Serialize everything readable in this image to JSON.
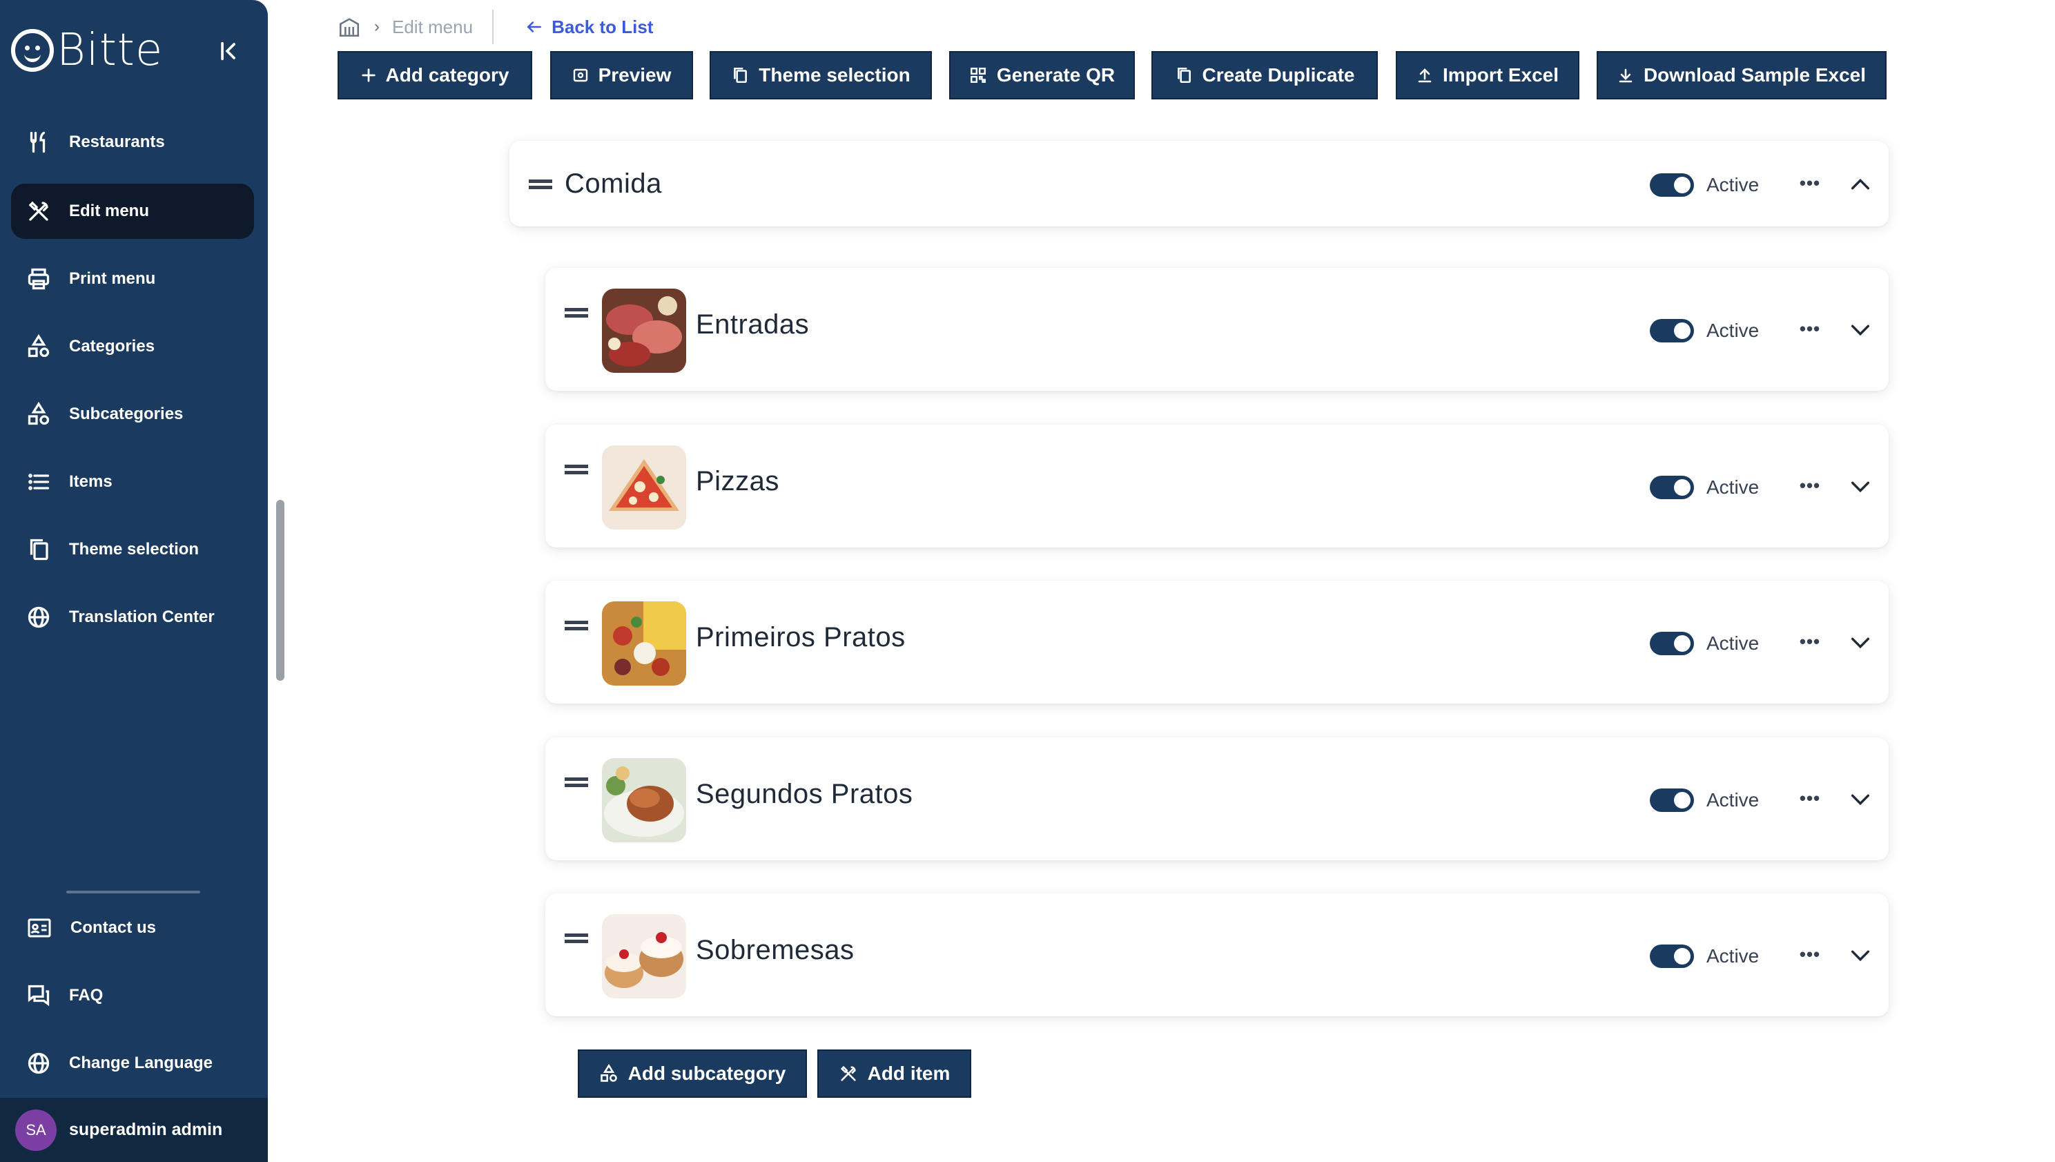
{
  "app": {
    "logo_text": "Bitte"
  },
  "sidebar": {
    "items": [
      {
        "label": "Restaurants",
        "icon": "fork-knife-icon"
      },
      {
        "label": "Edit menu",
        "icon": "crossed-utensils-icon"
      },
      {
        "label": "Print menu",
        "icon": "printer-icon"
      },
      {
        "label": "Categories",
        "icon": "shapes-icon"
      },
      {
        "label": "Subcategories",
        "icon": "shapes-icon"
      },
      {
        "label": "Items",
        "icon": "list-icon"
      },
      {
        "label": "Theme selection",
        "icon": "copy-document-icon"
      },
      {
        "label": "Translation Center",
        "icon": "globe-icon"
      }
    ],
    "bottom_items": [
      {
        "label": "Contact us",
        "icon": "contact-card-icon"
      },
      {
        "label": "FAQ",
        "icon": "chat-bubbles-icon"
      },
      {
        "label": "Change Language",
        "icon": "globe-icon"
      }
    ],
    "user": {
      "initials": "SA",
      "name": "superadmin admin"
    }
  },
  "header": {
    "breadcrumb_current": "Edit menu",
    "back_label": "Back to List"
  },
  "toolbar": {
    "add_category": "Add category",
    "preview": "Preview",
    "theme_selection": "Theme selection",
    "generate_qr": "Generate QR",
    "create_duplicate": "Create Duplicate",
    "import_excel": "Import Excel",
    "download_sample": "Download Sample Excel"
  },
  "category": {
    "name": "Comida",
    "status": "Active",
    "expanded": true
  },
  "subcategories": [
    {
      "name": "Entradas",
      "status": "Active"
    },
    {
      "name": "Pizzas",
      "status": "Active"
    },
    {
      "name": "Primeiros Pratos",
      "status": "Active"
    },
    {
      "name": "Segundos Pratos",
      "status": "Active"
    },
    {
      "name": "Sobremesas",
      "status": "Active"
    }
  ],
  "actions": {
    "add_subcategory": "Add subcategory",
    "add_item": "Add item"
  },
  "colors": {
    "primary": "#1a3a5f",
    "sidebar_active": "#0e1a2b",
    "link": "#3b5bdb",
    "avatar": "#7b3fa3"
  }
}
